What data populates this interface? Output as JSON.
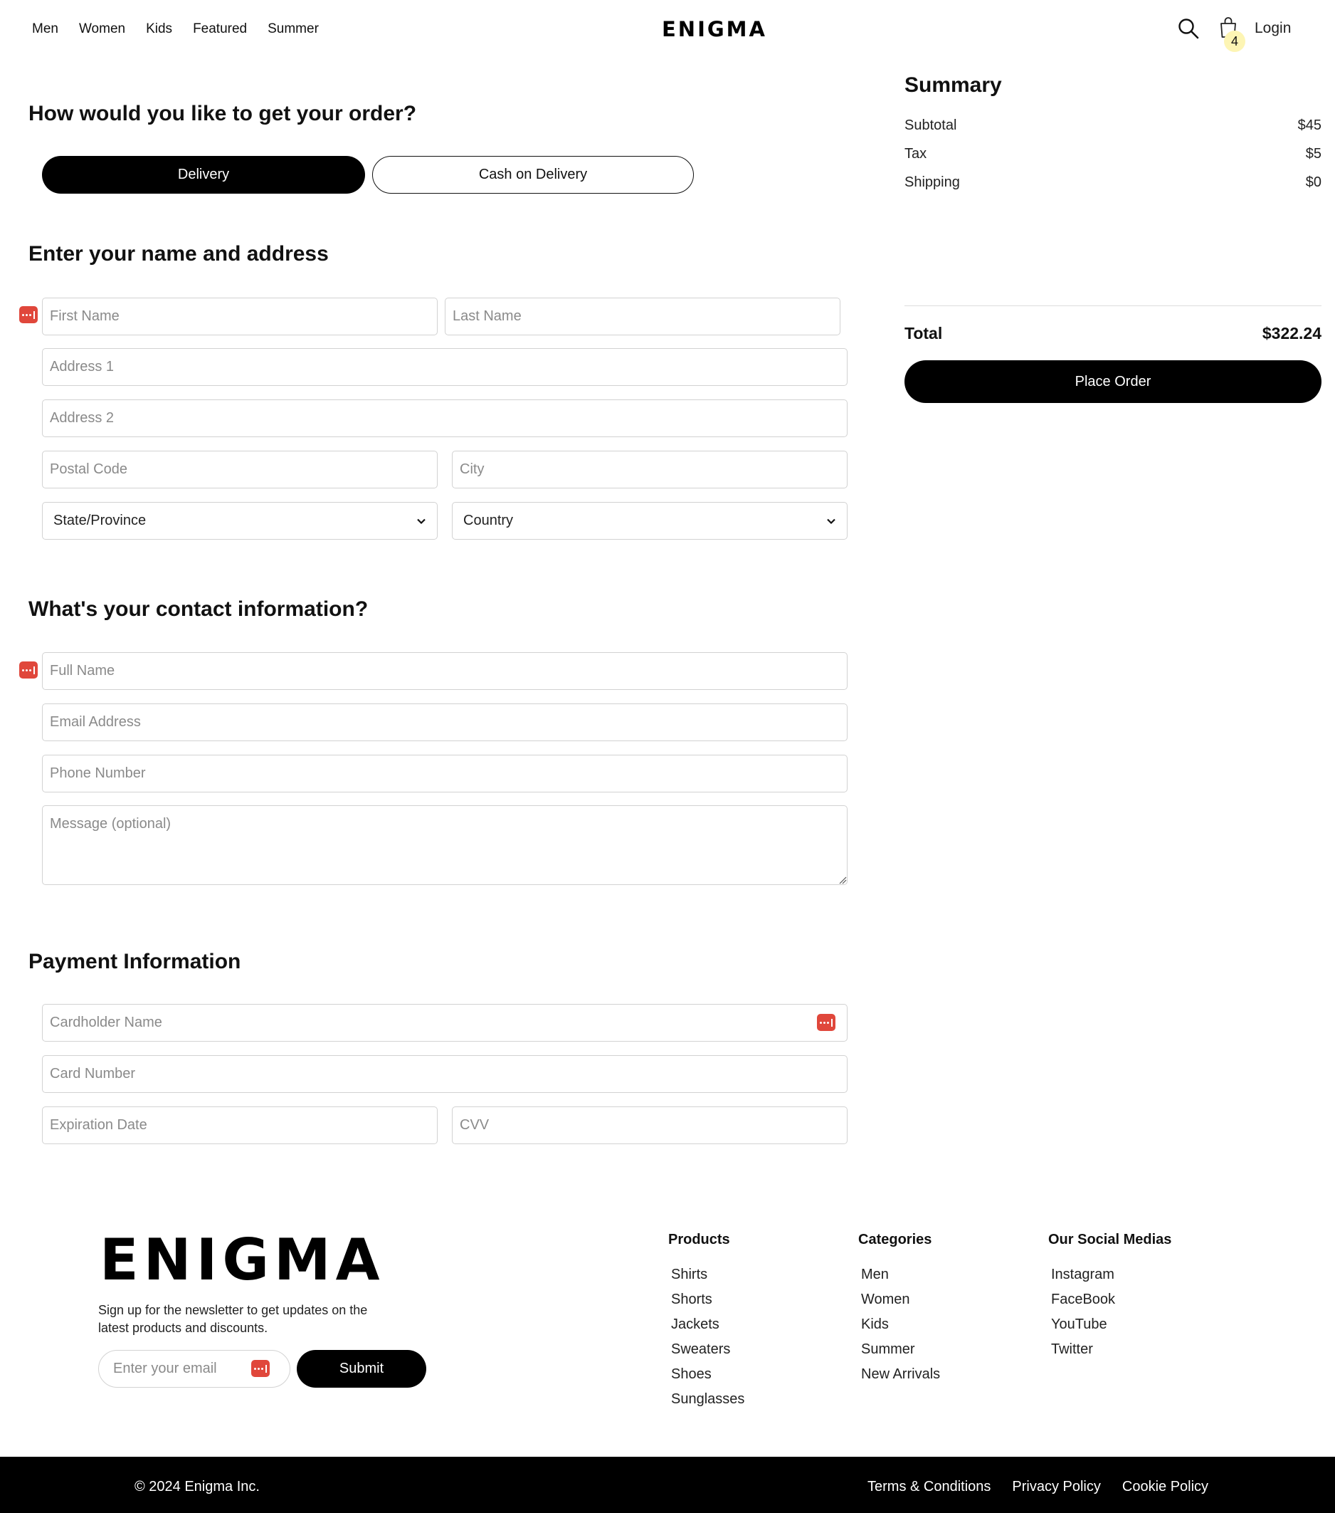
{
  "header": {
    "nav": [
      "Men",
      "Women",
      "Kids",
      "Featured",
      "Summer"
    ],
    "logo": "ENIGMA",
    "cart_count": "4",
    "login": "Login"
  },
  "order": {
    "heading": "How would you like to get your order?",
    "options": [
      "Delivery",
      "Cash on Delivery"
    ],
    "selected": "Delivery"
  },
  "address": {
    "heading": "Enter your name and address",
    "first_name": "First Name",
    "last_name": "Last Name",
    "address1": "Address 1",
    "address2": "Address 2",
    "postal_code": "Postal Code",
    "city": "City",
    "state": "State/Province",
    "country": "Country"
  },
  "contact": {
    "heading": "What's your contact information?",
    "full_name": "Full Name",
    "email": "Email Address",
    "phone": "Phone Number",
    "message": "Message (optional)"
  },
  "payment": {
    "heading": "Payment Information",
    "cardholder": "Cardholder Name",
    "card_number": "Card Number",
    "expiration": "Expiration Date",
    "cvv": "CVV"
  },
  "summary": {
    "title": "Summary",
    "rows": [
      {
        "label": "Subtotal",
        "value": "$45"
      },
      {
        "label": "Tax",
        "value": "$5"
      },
      {
        "label": "Shipping",
        "value": "$0"
      }
    ],
    "total_label": "Total",
    "total_value": "$322.24",
    "place_order": "Place Order"
  },
  "footer": {
    "logo": "ENIGMA",
    "newsletter": "Sign up for the newsletter to get updates on the latest products and discounts.",
    "email_placeholder": "Enter your email",
    "submit": "Submit",
    "columns": [
      {
        "title": "Products",
        "items": [
          "Shirts",
          "Shorts",
          "Jackets",
          "Sweaters",
          "Shoes",
          "Sunglasses"
        ]
      },
      {
        "title": "Categories",
        "items": [
          "Men",
          "Women",
          "Kids",
          "Summer",
          "New Arrivals"
        ]
      },
      {
        "title": "Our Social Medias",
        "items": [
          "Instagram",
          "FaceBook",
          "YouTube",
          "Twitter"
        ]
      }
    ],
    "copyright": "© 2024 Enigma Inc.",
    "legal": [
      "Terms & Conditions",
      "Privacy Policy",
      "Cookie Policy"
    ]
  },
  "colors": {
    "accent": "#000000",
    "badge": "#fdf5b4",
    "autofill_icon": "#e0473b",
    "field_border": "#d2d2d2"
  }
}
